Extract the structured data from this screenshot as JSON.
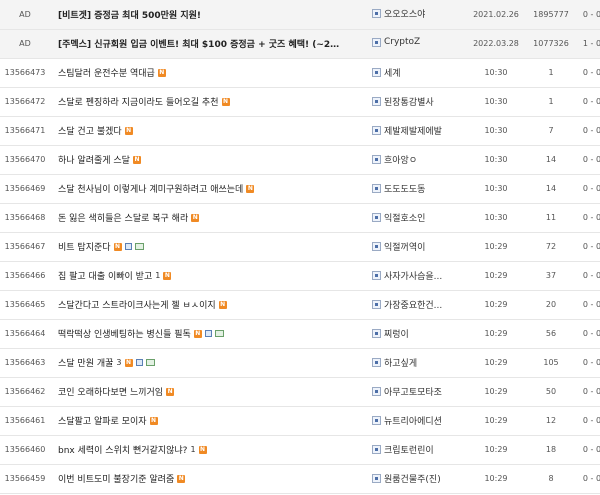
{
  "rows": [
    {
      "no": "AD",
      "title": "[비트겟] 증정금 최대 500만원 지원!",
      "ad": true,
      "comments": "",
      "icons": [],
      "author": "오오오스야",
      "date": "2021.02.26",
      "views": "1895777",
      "votes": "0 - 0"
    },
    {
      "no": "AD",
      "title": "[주멕스] 신규회원 입금 이벤트! 최대 $100 증정금 + 굿즈 혜택! (~2…",
      "ad": true,
      "comments": "",
      "icons": [],
      "author": "CryptoZ",
      "date": "2022.03.28",
      "views": "1077326",
      "votes": "1 - 0"
    },
    {
      "no": "13566473",
      "title": "스팀달러 운전수분 역대급",
      "ad": false,
      "comments": "",
      "icons": [
        "new"
      ],
      "author": "세계",
      "date": "10:30",
      "views": "1",
      "votes": "0 - 0"
    },
    {
      "no": "13566472",
      "title": "스달로 펜징하라 지금이라도 들어오길 추천",
      "ad": false,
      "comments": "",
      "icons": [
        "new"
      ],
      "author": "된장통감별사",
      "date": "10:30",
      "views": "1",
      "votes": "0 - 0"
    },
    {
      "no": "13566471",
      "title": "스달 건고 불겠다",
      "ad": false,
      "comments": "",
      "icons": [
        "new"
      ],
      "author": "제발제발제에발",
      "date": "10:30",
      "views": "7",
      "votes": "0 - 0"
    },
    {
      "no": "13566470",
      "title": "하나 알려줄게 스달",
      "ad": false,
      "comments": "",
      "icons": [
        "new"
      ],
      "author": "흐아앙ㅇ",
      "date": "10:30",
      "views": "14",
      "votes": "0 - 0"
    },
    {
      "no": "13566469",
      "title": "스달 천사님이 이렇게나 계미구원하려고 애쓰는데",
      "ad": false,
      "comments": "",
      "icons": [
        "new"
      ],
      "author": "도도도도동",
      "date": "10:30",
      "views": "14",
      "votes": "0 - 0"
    },
    {
      "no": "13566468",
      "title": "돈 잃은 색히들은 스달로 복구 해라",
      "ad": false,
      "comments": "",
      "icons": [
        "new"
      ],
      "author": "익절호소인",
      "date": "10:30",
      "views": "11",
      "votes": "0 - 0"
    },
    {
      "no": "13566467",
      "title": "비트 탑지준다",
      "ad": false,
      "comments": "",
      "icons": [
        "new",
        "save",
        "img"
      ],
      "author": "익절꺼역이",
      "date": "10:29",
      "views": "72",
      "votes": "0 - 0"
    },
    {
      "no": "13566466",
      "title": "집 팔고 대출 이빠이 받고",
      "ad": false,
      "comments": "1",
      "icons": [
        "new"
      ],
      "author": "사자가사슴을...",
      "date": "10:29",
      "views": "37",
      "votes": "0 - 0"
    },
    {
      "no": "13566465",
      "title": "스달간다고 스트라이크사는게 젤 ㅂㅅ이지",
      "ad": false,
      "comments": "",
      "icons": [
        "new"
      ],
      "author": "가장중요한건...",
      "date": "10:29",
      "views": "20",
      "votes": "0 - 0"
    },
    {
      "no": "13566464",
      "title": "떡락떡상 인생베팅하는 병신들 필독",
      "ad": false,
      "comments": "",
      "icons": [
        "new",
        "save",
        "img"
      ],
      "author": "찌렁이",
      "date": "10:29",
      "views": "56",
      "votes": "0 - 0"
    },
    {
      "no": "13566463",
      "title": "스달 만원 개꿀",
      "ad": false,
      "comments": "3",
      "icons": [
        "new",
        "save",
        "img"
      ],
      "author": "하고싶게",
      "date": "10:29",
      "views": "105",
      "votes": "0 - 0"
    },
    {
      "no": "13566462",
      "title": "코인 오래하다보면 느끼거임",
      "ad": false,
      "comments": "",
      "icons": [
        "new"
      ],
      "author": "아무고토모타조",
      "date": "10:29",
      "views": "50",
      "votes": "0 - 0"
    },
    {
      "no": "13566461",
      "title": "스달팔고 알파로 모이자",
      "ad": false,
      "comments": "",
      "icons": [
        "new"
      ],
      "author": "뉴트리아에디션",
      "date": "10:29",
      "views": "12",
      "votes": "0 - 0"
    },
    {
      "no": "13566460",
      "title": "bnx 세력이 스위치 뻔거같지않냐?",
      "ad": false,
      "comments": "1",
      "icons": [
        "new"
      ],
      "author": "크립토런린이",
      "date": "10:29",
      "views": "18",
      "votes": "0 - 0"
    },
    {
      "no": "13566459",
      "title": "이번 비트도미 불장기준 알려줌",
      "ad": false,
      "comments": "",
      "icons": [
        "new"
      ],
      "author": "원룸건물주(진)",
      "date": "10:29",
      "views": "8",
      "votes": "0 - 0"
    }
  ],
  "icon_names": {
    "new": "new-post-icon",
    "save": "attachment-icon",
    "img": "image-icon"
  },
  "colors": {
    "new_badge": "#f08a24",
    "ad_row_bg": "#f4f4f4",
    "border": "#e6e6e6"
  }
}
